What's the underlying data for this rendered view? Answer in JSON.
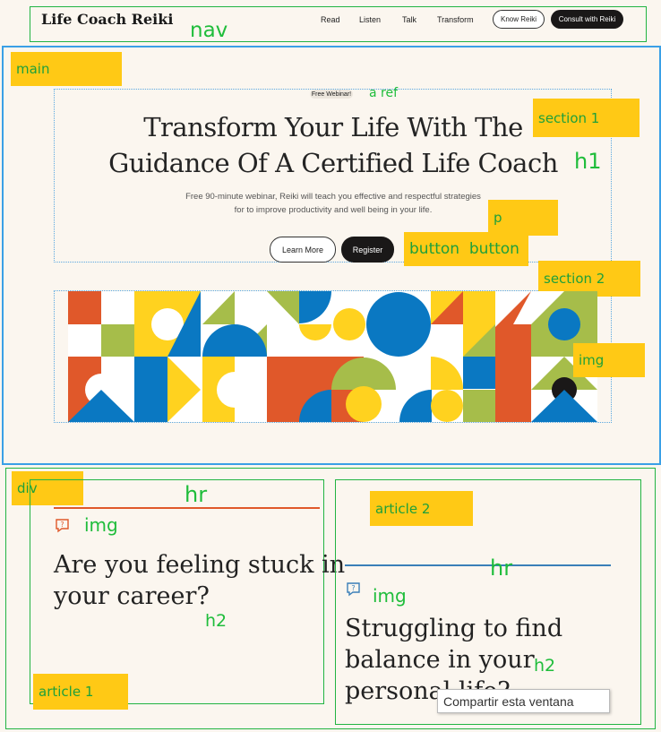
{
  "nav": {
    "logo": "Life Coach Reiki",
    "links": [
      "Read",
      "Listen",
      "Talk",
      "Transform"
    ],
    "know_button": "Know Reiki",
    "consult_button": "Consult with Reiki"
  },
  "hero": {
    "badge": "Free Webinar!",
    "title_line1": "Transform Your Life With The",
    "title_line2": "Guidance Of A Certified Life Coach",
    "subtitle_line1": "Free 90-minute webinar, Reiki will teach you effective and respectful strategies",
    "subtitle_line2": "for to improve productivity and well being in your life.",
    "learn_more": "Learn More",
    "register": "Register"
  },
  "articles": [
    {
      "title_line1": "Are you feeling stuck in",
      "title_line2": "your career?",
      "accent": "#e0582a"
    },
    {
      "title_line1": "Struggling to find",
      "title_line2": "balance in your",
      "title_line3": "personal life?",
      "accent": "#3a7fb8"
    }
  ],
  "annotations": {
    "nav": "nav",
    "main": "main",
    "a_ref": "a ref",
    "section1": "section 1",
    "h1": "h1",
    "p": "p",
    "buttons": "button  button",
    "section2": "section 2",
    "img": "img",
    "div": "div",
    "hr": "hr",
    "article1": "article 1",
    "article2": "article 2",
    "h2": "h2"
  },
  "tooltip": "Compartir esta ventana",
  "colors": {
    "orange": "#e0582a",
    "yellow": "#ffd21f",
    "blue": "#0a78c2",
    "green": "#a6bd4a",
    "black": "#1a1818",
    "white": "#ffffff"
  }
}
